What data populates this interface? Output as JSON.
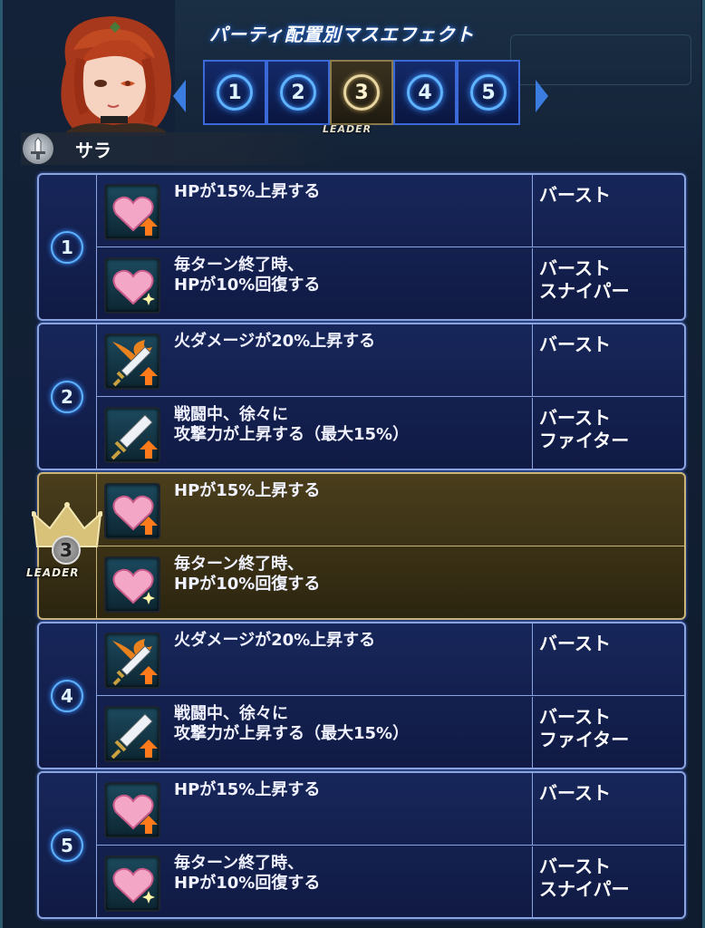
{
  "header": {
    "title": "パーティ配置別マスエフェクト",
    "leader_label": "LEADER"
  },
  "tabs": [
    {
      "label": "1",
      "active": false
    },
    {
      "label": "2",
      "active": false
    },
    {
      "label": "3",
      "active": true
    },
    {
      "label": "4",
      "active": false
    },
    {
      "label": "5",
      "active": false
    }
  ],
  "character": {
    "name": "サラ",
    "weapon_icon": "sword-icon"
  },
  "groups": [
    {
      "number": "1",
      "leader": false,
      "effects": [
        {
          "icon": "heart-up-icon",
          "description": "HPが15%上昇する",
          "type": "バースト"
        },
        {
          "icon": "heart-heal-icon",
          "description": "毎ターン終了時、\nHPが10%回復する",
          "type": "バースト\nスナイパー"
        }
      ]
    },
    {
      "number": "2",
      "leader": false,
      "effects": [
        {
          "icon": "fire-sword-icon",
          "description": "火ダメージが20%上昇する",
          "type": "バースト"
        },
        {
          "icon": "sword-up-icon",
          "description": "戦闘中、徐々に\n攻撃力が上昇する（最大15%）",
          "type": "バースト\nファイター"
        }
      ]
    },
    {
      "number": "3",
      "leader": true,
      "leader_label": "LEADER",
      "effects": [
        {
          "icon": "heart-up-icon",
          "description": "HPが15%上昇する",
          "type": ""
        },
        {
          "icon": "heart-heal-icon",
          "description": "毎ターン終了時、\nHPが10%回復する",
          "type": ""
        }
      ]
    },
    {
      "number": "4",
      "leader": false,
      "effects": [
        {
          "icon": "fire-sword-icon",
          "description": "火ダメージが20%上昇する",
          "type": "バースト"
        },
        {
          "icon": "sword-up-icon",
          "description": "戦闘中、徐々に\n攻撃力が上昇する（最大15%）",
          "type": "バースト\nファイター"
        }
      ]
    },
    {
      "number": "5",
      "leader": false,
      "effects": [
        {
          "icon": "heart-up-icon",
          "description": "HPが15%上昇する",
          "type": "バースト"
        },
        {
          "icon": "heart-heal-icon",
          "description": "毎ターン終了時、\nHPが10%回復する",
          "type": "バースト\nスナイパー"
        }
      ]
    }
  ]
}
